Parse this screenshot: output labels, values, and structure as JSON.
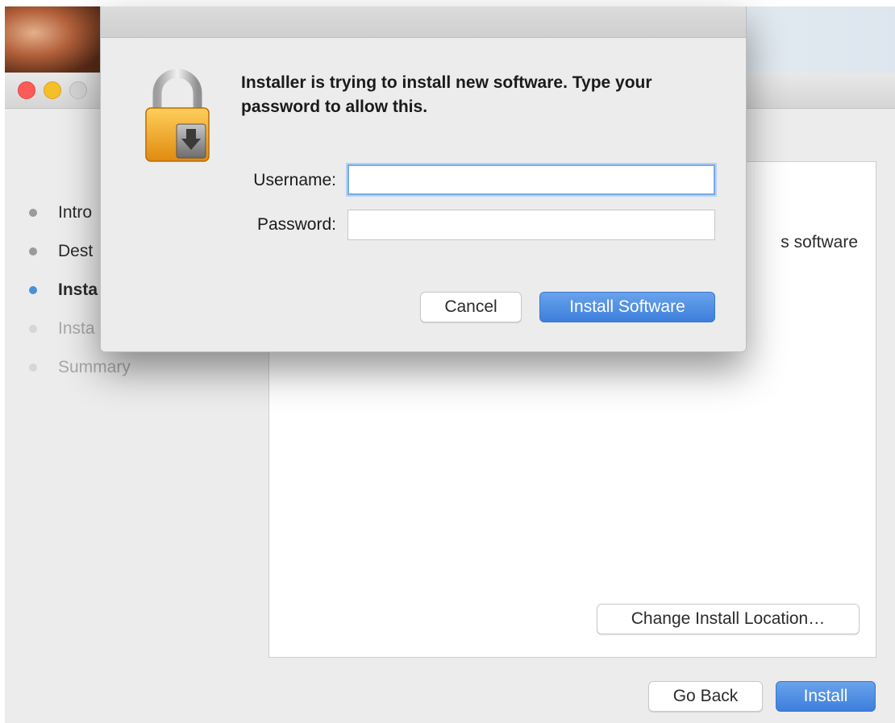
{
  "window": {
    "steps": [
      {
        "label": "Intro",
        "state": "done"
      },
      {
        "label": "Dest",
        "state": "done"
      },
      {
        "label": "Insta",
        "state": "current"
      },
      {
        "label": "Insta",
        "state": "pending"
      },
      {
        "label": "Summary",
        "state": "pending"
      }
    ],
    "content_text": "s software",
    "change_location_label": "Change Install Location…",
    "go_back_label": "Go Back",
    "install_label": "Install"
  },
  "auth_dialog": {
    "message": "Installer is trying to install new software. Type your password to allow this.",
    "username_label": "Username:",
    "username_value": "",
    "password_label": "Password:",
    "password_value": "",
    "cancel_label": "Cancel",
    "install_software_label": "Install Software"
  },
  "icons": {
    "lock": "lock-icon",
    "close": "close-window-icon",
    "minimize": "minimize-window-icon",
    "zoom": "zoom-window-icon"
  },
  "colors": {
    "accent": "#3d7fdc",
    "current_step": "#4a90d9",
    "close": "#fc5b57",
    "minimize": "#f5bf2a"
  }
}
